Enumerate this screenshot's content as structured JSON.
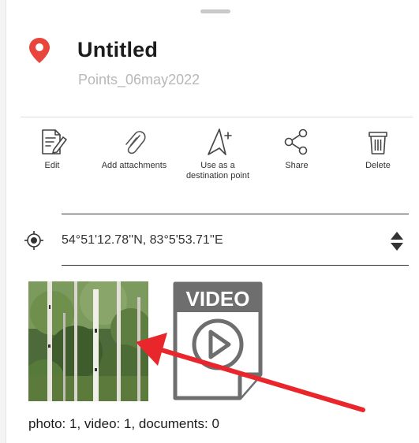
{
  "header": {
    "title": "Untitled",
    "subtitle": "Points_06may2022"
  },
  "actions": [
    {
      "label": "Edit",
      "icon": "edit-icon"
    },
    {
      "label": "Add attachments",
      "icon": "paperclip-icon"
    },
    {
      "label": "Use as a destination point",
      "icon": "navigation-plus-icon"
    },
    {
      "label": "Share",
      "icon": "share-icon"
    },
    {
      "label": "Delete",
      "icon": "trash-icon"
    }
  ],
  "location": {
    "coordinates": "54°51'12.78''N, 83°5'53.71''E",
    "icon": "target-icon"
  },
  "media": {
    "video_label": "VIDEO",
    "counts": "photo: 1, video: 1, documents: 0"
  },
  "colors": {
    "pin": "#e8453c",
    "annotation_arrow": "#e8262b",
    "video_icon": "#6e6e6e"
  }
}
